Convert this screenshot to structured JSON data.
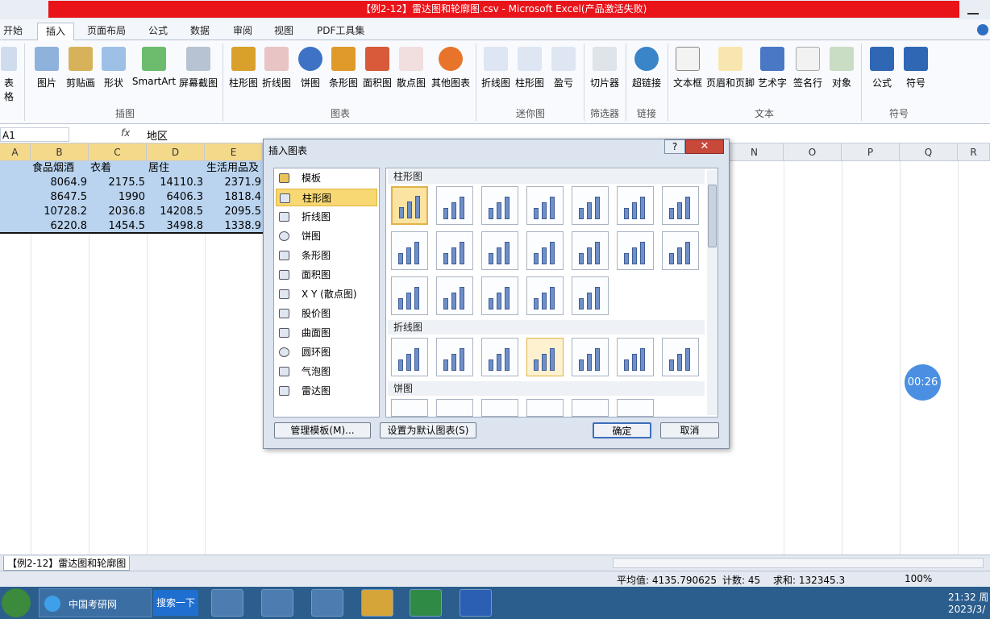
{
  "window": {
    "title": "【例2-12】雷达图和轮廓图.csv - Microsoft Excel(产品激活失败)"
  },
  "tabs": [
    "开始",
    "插入",
    "页面布局",
    "公式",
    "数据",
    "审阅",
    "视图",
    "PDF工具集"
  ],
  "ribbon": {
    "buttons": [
      "表格",
      "图片",
      "剪贴画",
      "形状",
      "SmartArt",
      "屏幕截图",
      "柱形图",
      "折线图",
      "饼图",
      "条形图",
      "面积图",
      "散点图",
      "其他图表",
      "折线图",
      "柱形图",
      "盈亏",
      "切片器",
      "超链接",
      "文本框",
      "页眉和页脚",
      "艺术字",
      "签名行",
      "对象",
      "公式",
      "符号"
    ],
    "groups": [
      "插图",
      "图表",
      "迷你图",
      "筛选器",
      "链接",
      "文本",
      "符号"
    ]
  },
  "formula_bar": {
    "name_box": "A1",
    "fx": "fx",
    "value": "地区"
  },
  "sheet": {
    "col_headers": [
      "A",
      "B",
      "C",
      "D",
      "E",
      "N",
      "O",
      "P",
      "Q",
      "R"
    ],
    "header_row": [
      "食品烟酒",
      "衣着",
      "居住",
      "生活用品及"
    ],
    "rows": [
      [
        "8064.9",
        "2175.5",
        "14110.3",
        "2371.9"
      ],
      [
        "8647.5",
        "1990",
        "6406.3",
        "1818.4"
      ],
      [
        "10728.2",
        "2036.8",
        "14208.5",
        "2095.5"
      ],
      [
        "6220.8",
        "1454.5",
        "3498.8",
        "1338.9"
      ]
    ],
    "tab_name": "【例2-12】雷达图和轮廓图"
  },
  "dialog": {
    "title": "插入图表",
    "help": "?",
    "close": "✕",
    "types": [
      "模板",
      "柱形图",
      "折线图",
      "饼图",
      "条形图",
      "面积图",
      "X Y (散点图)",
      "股价图",
      "曲面图",
      "圆环图",
      "气泡图",
      "雷达图"
    ],
    "selected_type": "柱形图",
    "sections": [
      "柱形图",
      "折线图",
      "饼图"
    ],
    "buttons": {
      "manage": "管理模板(M)...",
      "default": "设置为默认图表(S)",
      "ok": "确定",
      "cancel": "取消"
    }
  },
  "status": {
    "average": "平均值: 4135.790625",
    "count": "计数: 45",
    "sum": "求和: 132345.3",
    "zoom": "100%"
  },
  "taskbar": {
    "ie_label": "中国考研网",
    "search": "搜索一下",
    "time": "21:32 周",
    "date": "2023/3/"
  },
  "timer": "00:26"
}
